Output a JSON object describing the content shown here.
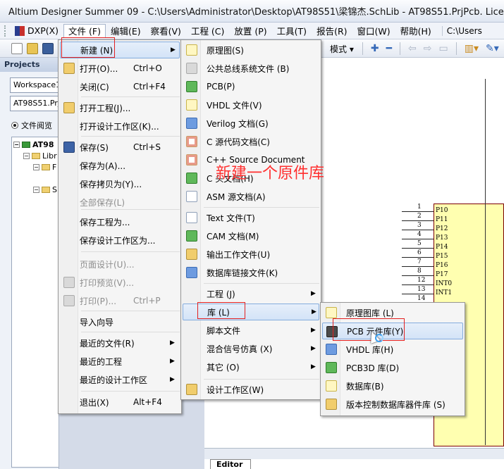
{
  "window": {
    "title": "Altium Designer Summer 09 - C:\\Users\\Administrator\\Desktop\\AT98S51\\梁锦杰.SchLib - AT98S51.PrjPcb. Licensed to N"
  },
  "menubar": {
    "items": [
      "DXP(X)",
      "文件 (F)",
      "编辑(E)",
      "察看(V)",
      "工程 (C)",
      "放置 (P)",
      "工具(T)",
      "报告(R)",
      "窗口(W)",
      "帮助(H)"
    ],
    "path": "C:\\Users"
  },
  "toolbar": {
    "mode_label": "模式"
  },
  "projects_panel": {
    "header": "Projects",
    "workspace_field": "Workspace1",
    "project_field": "AT98S51.Prj",
    "view_radio": "文件阅览",
    "tree": {
      "root": "AT98",
      "libraries": "Libr",
      "f_node": "F",
      "s_node": "S"
    }
  },
  "file_menu": {
    "items": [
      {
        "label": "新建 (N)",
        "shortcut": "",
        "submenu": true,
        "disabled": false
      },
      {
        "label": "打开(O)...",
        "shortcut": "Ctrl+O",
        "submenu": false,
        "disabled": false
      },
      {
        "label": "关闭(C)",
        "shortcut": "Ctrl+F4",
        "submenu": false,
        "disabled": false
      },
      {
        "label": "打开工程(J)...",
        "shortcut": "",
        "submenu": false,
        "disabled": false
      },
      {
        "label": "打开设计工作区(K)...",
        "shortcut": "",
        "submenu": false,
        "disabled": false
      },
      {
        "label": "保存(S)",
        "shortcut": "Ctrl+S",
        "submenu": false,
        "disabled": false
      },
      {
        "label": "保存为(A)...",
        "shortcut": "",
        "submenu": false,
        "disabled": false
      },
      {
        "label": "保存拷贝为(Y)...",
        "shortcut": "",
        "submenu": false,
        "disabled": false
      },
      {
        "label": "全部保存(L)",
        "shortcut": "",
        "submenu": false,
        "disabled": true
      },
      {
        "label": "保存工程为...",
        "shortcut": "",
        "submenu": false,
        "disabled": false
      },
      {
        "label": "保存设计工作区为...",
        "shortcut": "",
        "submenu": false,
        "disabled": false
      },
      {
        "label": "页面设计(U)...",
        "shortcut": "",
        "submenu": false,
        "disabled": true
      },
      {
        "label": "打印预览(V)...",
        "shortcut": "",
        "submenu": false,
        "disabled": true
      },
      {
        "label": "打印(P)...",
        "shortcut": "Ctrl+P",
        "submenu": false,
        "disabled": true
      },
      {
        "label": "导入向导",
        "shortcut": "",
        "submenu": false,
        "disabled": false
      },
      {
        "label": "最近的文件(R)",
        "shortcut": "",
        "submenu": true,
        "disabled": false
      },
      {
        "label": "最近的工程",
        "shortcut": "",
        "submenu": true,
        "disabled": false
      },
      {
        "label": "最近的设计工作区",
        "shortcut": "",
        "submenu": true,
        "disabled": false
      },
      {
        "label": "退出(X)",
        "shortcut": "Alt+F4",
        "submenu": false,
        "disabled": false
      }
    ]
  },
  "new_menu": {
    "items": [
      {
        "label": "原理图(S)",
        "submenu": false
      },
      {
        "label": "公共总线系统文件 (B)",
        "submenu": false
      },
      {
        "label": "PCB(P)",
        "submenu": false
      },
      {
        "label": "VHDL 文件(V)",
        "submenu": false
      },
      {
        "label": "Verilog 文档(G)",
        "submenu": false
      },
      {
        "label": "C 源代码文档(C)",
        "submenu": false
      },
      {
        "label": "C++ Source Document",
        "submenu": false
      },
      {
        "label": "C 头文档(H)",
        "submenu": false
      },
      {
        "label": "ASM 源文档(A)",
        "submenu": false
      },
      {
        "label": "Text  文件(T)",
        "submenu": false
      },
      {
        "label": "CAM 文档(M)",
        "submenu": false
      },
      {
        "label": "输出工作文件(U)",
        "submenu": false
      },
      {
        "label": "数据库链接文件(K)",
        "submenu": false
      },
      {
        "label": "工程 (J)",
        "submenu": true
      },
      {
        "label": "库 (L)",
        "submenu": true
      },
      {
        "label": "脚本文件",
        "submenu": true
      },
      {
        "label": "混合信号仿真 (X)",
        "submenu": true
      },
      {
        "label": "其它 (O)",
        "submenu": true
      },
      {
        "label": "设计工作区(W)",
        "submenu": false
      }
    ]
  },
  "library_menu": {
    "items": [
      {
        "label": "原理图库 (L)"
      },
      {
        "label": "PCB 元件库(Y)"
      },
      {
        "label": "VHDL 库(H)"
      },
      {
        "label": "PCB3D 库(D)"
      },
      {
        "label": "数据库(B)"
      },
      {
        "label": "版本控制数据库器件库 (S)"
      }
    ]
  },
  "annotation": "新建一个原件库",
  "schematic": {
    "pins": [
      {
        "num": "1",
        "name": "P10"
      },
      {
        "num": "2",
        "name": "P11"
      },
      {
        "num": "3",
        "name": "P12"
      },
      {
        "num": "4",
        "name": "P13"
      },
      {
        "num": "5",
        "name": "P14"
      },
      {
        "num": "6",
        "name": "P15"
      },
      {
        "num": "7",
        "name": "P16"
      },
      {
        "num": "8",
        "name": "P17"
      },
      {
        "num": "12",
        "name": "INT0"
      },
      {
        "num": "13",
        "name": "INT1"
      },
      {
        "num": "14",
        "name": ""
      }
    ]
  },
  "editor_tab": "Editor",
  "colors": {
    "highlight_border": "#84acdd",
    "annotation_red": "#ff3030",
    "component_fill": "#ffffb0"
  }
}
